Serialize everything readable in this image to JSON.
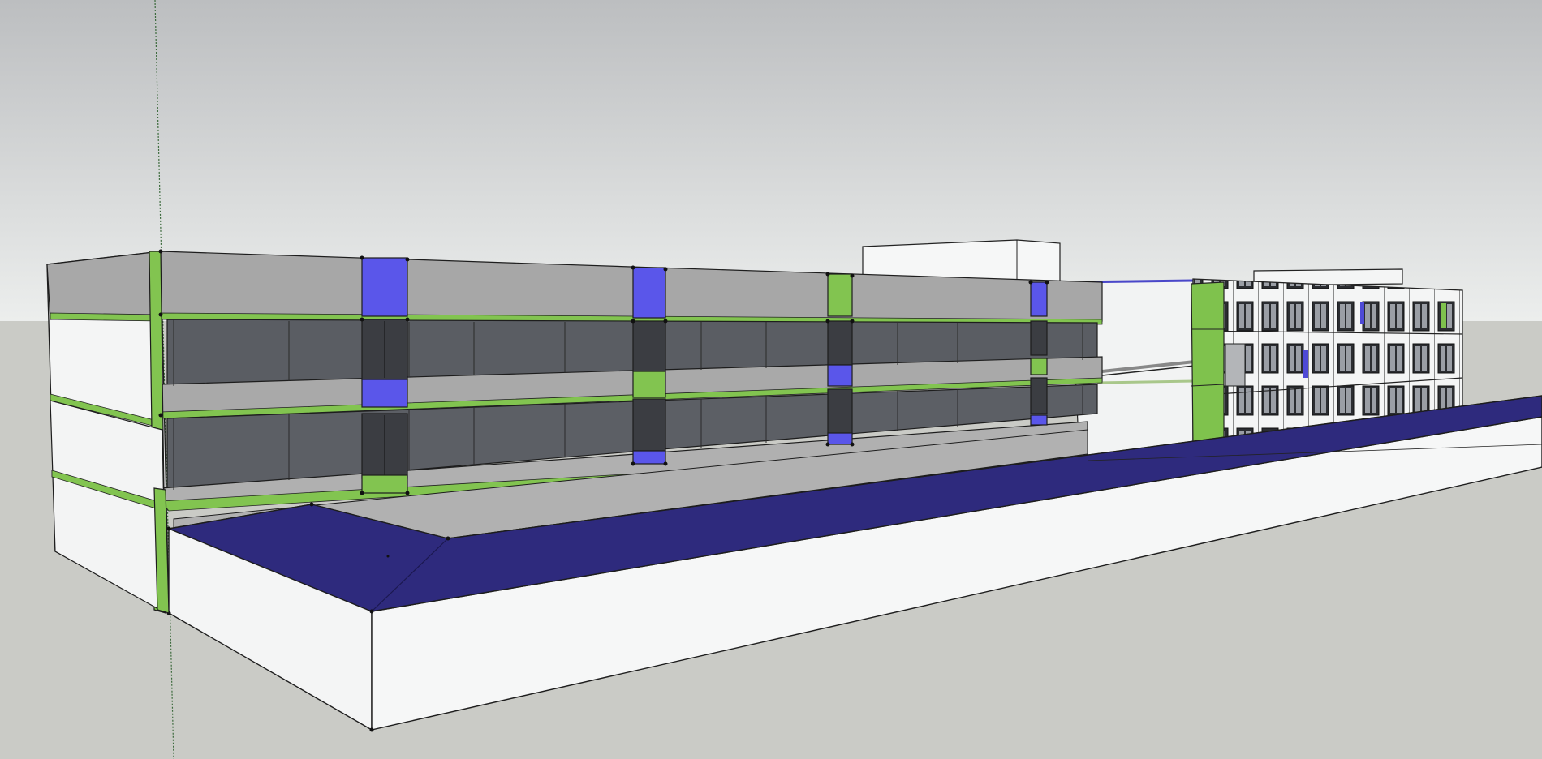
{
  "app": {
    "kind": "3d-modeling-viewport"
  },
  "colors": {
    "sky_top": "#bfc1c3",
    "sky_bottom": "#e9eceb",
    "ground": "#cacbc6",
    "facade_gray": "#a7a7a7",
    "glass_dark": "#5a5d63",
    "accent_green": "#82c450",
    "accent_blue": "#5a56ea",
    "roof_navy": "#2e2a7d",
    "wall_white": "#f6f7f7",
    "edge": "#1d1d1d"
  }
}
